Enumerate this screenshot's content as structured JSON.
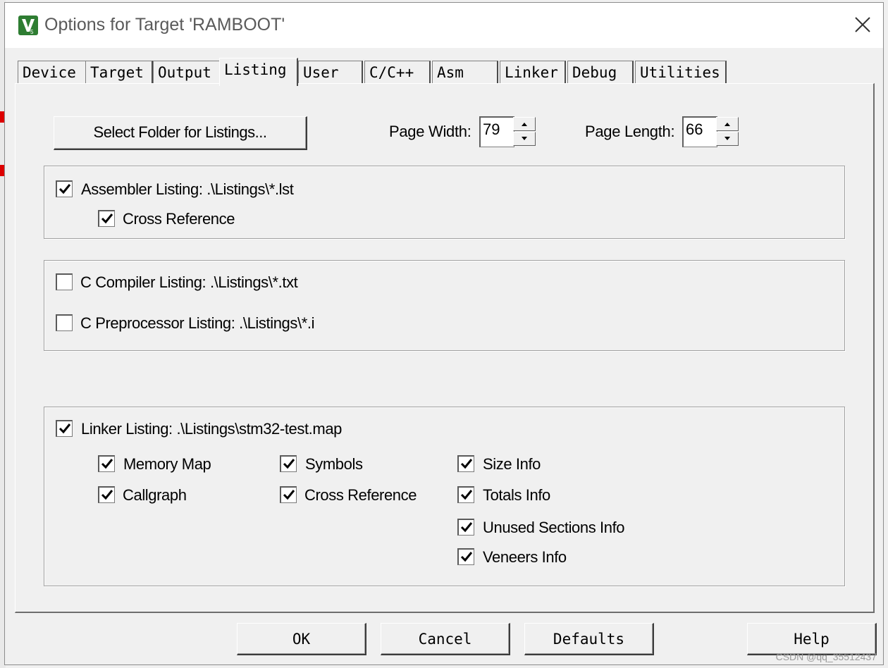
{
  "window": {
    "title": "Options for Target 'RAMBOOT'"
  },
  "tabs": [
    {
      "label": "Device",
      "active": false
    },
    {
      "label": "Target",
      "active": false
    },
    {
      "label": "Output",
      "active": false
    },
    {
      "label": "Listing",
      "active": true
    },
    {
      "label": "User",
      "active": false
    },
    {
      "label": "C/C++",
      "active": false
    },
    {
      "label": "Asm",
      "active": false
    },
    {
      "label": "Linker",
      "active": false
    },
    {
      "label": "Debug",
      "active": false
    },
    {
      "label": "Utilities",
      "active": false
    }
  ],
  "listing": {
    "select_folder_label": "Select Folder for Listings...",
    "page_width_label": "Page Width:",
    "page_width_value": "79",
    "page_length_label": "Page Length:",
    "page_length_value": "66",
    "assembler": {
      "label": "Assembler Listing:  .\\Listings\\*.lst",
      "checked": true,
      "cross_reference": {
        "label": "Cross Reference",
        "checked": true
      }
    },
    "compiler": {
      "c_compiler": {
        "label": "C Compiler Listing:  .\\Listings\\*.txt",
        "checked": false
      },
      "c_preprocessor": {
        "label": "C Preprocessor Listing:  .\\Listings\\*.i",
        "checked": false
      }
    },
    "linker": {
      "label": "Linker Listing:  .\\Listings\\stm32-test.map",
      "checked": true,
      "options": [
        {
          "label": "Memory Map",
          "checked": true
        },
        {
          "label": "Symbols",
          "checked": true
        },
        {
          "label": "Size Info",
          "checked": true
        },
        {
          "label": "Callgraph",
          "checked": true
        },
        {
          "label": "Cross Reference",
          "checked": true
        },
        {
          "label": "Totals Info",
          "checked": true
        },
        {
          "label": "Unused Sections Info",
          "checked": true
        },
        {
          "label": "Veneers Info",
          "checked": true
        }
      ]
    }
  },
  "buttons": {
    "ok": "OK",
    "cancel": "Cancel",
    "defaults": "Defaults",
    "help": "Help"
  },
  "watermark": "CSDN @qq_35512437",
  "colors": {
    "checkmark": "#000000",
    "title_text": "#5a5a5a",
    "window_bg": "#f0f0f0"
  }
}
